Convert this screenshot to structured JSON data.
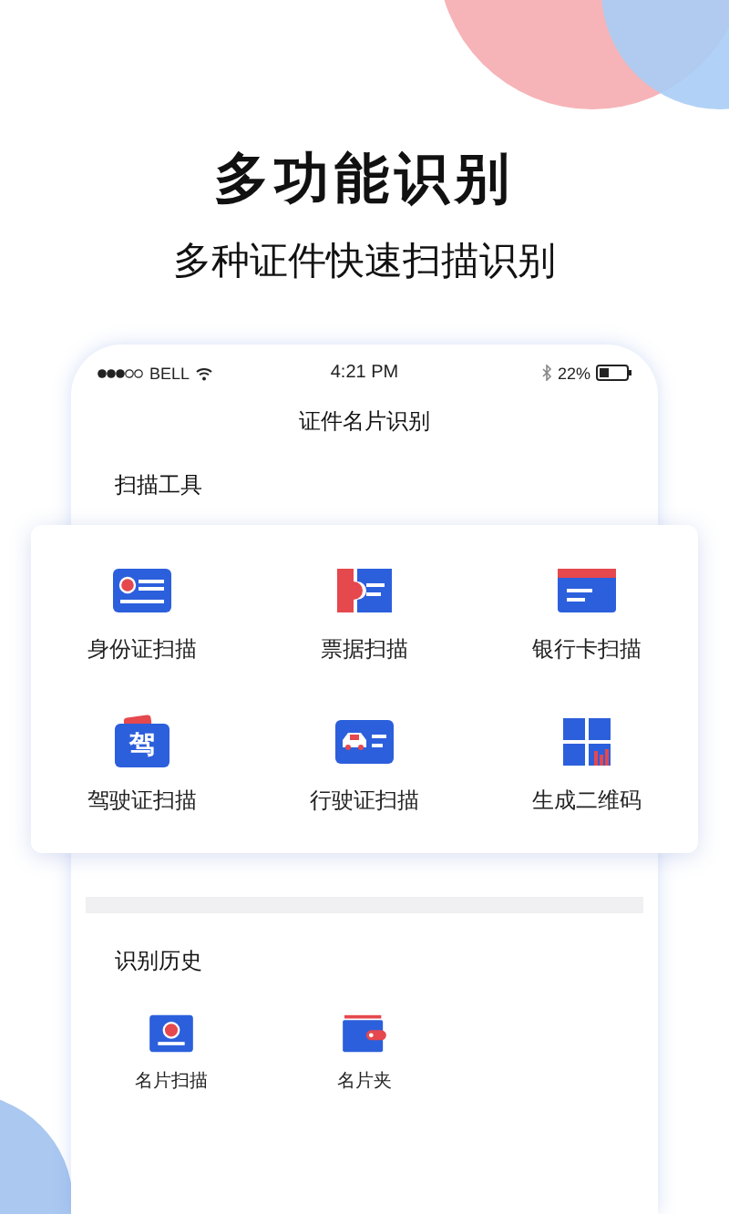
{
  "headline": "多功能识别",
  "subtitle": "多种证件快速扫描识别",
  "status_bar": {
    "carrier": "BELL",
    "time": "4:21 PM",
    "battery": "22%"
  },
  "screen_title": "证件名片识别",
  "tools_heading": "扫描工具",
  "tools": [
    {
      "kind": "id-card",
      "label": "身份证扫描"
    },
    {
      "kind": "ticket",
      "label": "票据扫描"
    },
    {
      "kind": "bank-card",
      "label": "银行卡扫描"
    },
    {
      "kind": "license",
      "label": "驾驶证扫描",
      "badge": "驾"
    },
    {
      "kind": "car-card",
      "label": "行驶证扫描"
    },
    {
      "kind": "qr",
      "label": "生成二维码"
    }
  ],
  "history_heading": "识别历史",
  "history": [
    {
      "kind": "card-scan",
      "label": "名片扫描"
    },
    {
      "kind": "wallet",
      "label": "名片夹"
    }
  ]
}
